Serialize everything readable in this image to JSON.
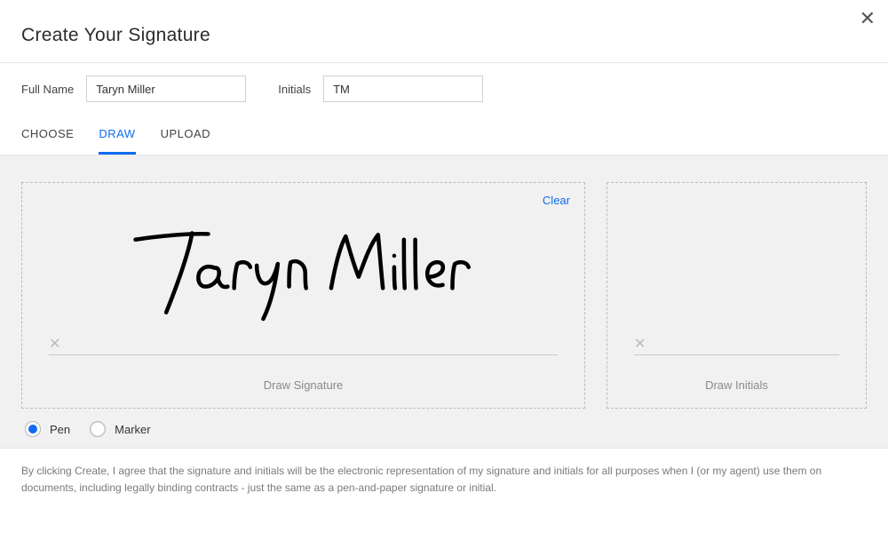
{
  "modal": {
    "title": "Create Your Signature"
  },
  "fields": {
    "full_name_label": "Full Name",
    "full_name_value": "Taryn Miller",
    "initials_label": "Initials",
    "initials_value": "TM"
  },
  "tabs": {
    "choose": "CHOOSE",
    "draw": "DRAW",
    "upload": "UPLOAD",
    "active": "draw"
  },
  "signature_box": {
    "clear_label": "Clear",
    "caption": "Draw Signature",
    "drawn_text": "Taryn Miller"
  },
  "initials_box": {
    "caption": "Draw Initials"
  },
  "tools": {
    "pen_label": "Pen",
    "marker_label": "Marker",
    "selected": "pen"
  },
  "disclaimer": {
    "text": "By clicking Create, I agree that the signature and initials will be the electronic representation of my signature and initials for all purposes when I (or my agent) use them on documents, including legally binding contracts - just the same as a pen-and-paper signature or initial."
  }
}
